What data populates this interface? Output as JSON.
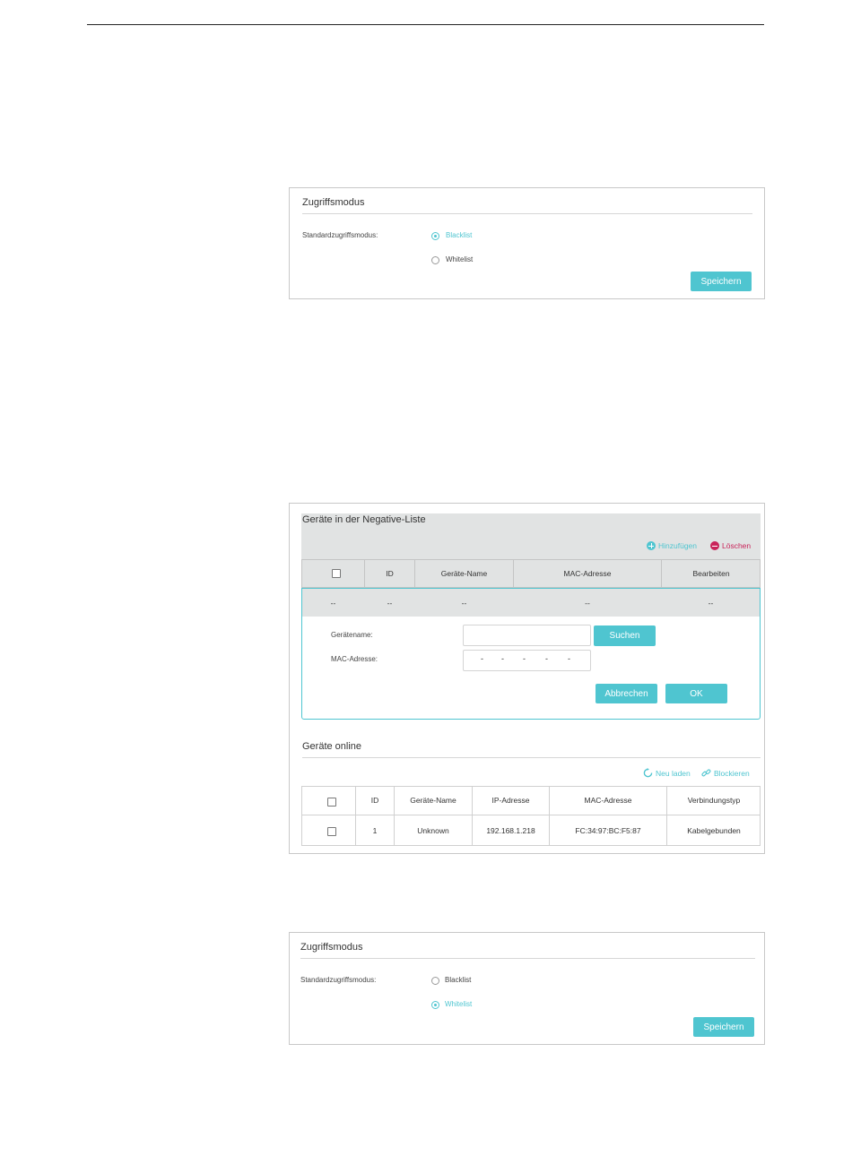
{
  "panel1": {
    "title": "Zugriffsmodus",
    "mode_label": "Standardzugriffsmodus:",
    "option_blacklist": "Blacklist",
    "option_whitelist": "Whitelist",
    "selected": "Blacklist",
    "save_label": "Speichern"
  },
  "panel2": {
    "title": "Geräte in der Negative-Liste",
    "add_label": "Hinzufügen",
    "delete_label": "Löschen",
    "columns": [
      "ID",
      "Geräte-Name",
      "MAC-Adresse",
      "Bearbeiten"
    ],
    "row": [
      "--",
      "--",
      "--",
      "--",
      "--"
    ],
    "form": {
      "device_name_label": "Gerätename:",
      "device_name_value": "",
      "search_label": "Suchen",
      "mac_label": "MAC-Adresse:",
      "mac_separators": [
        "-",
        "-",
        "-",
        "-",
        "-"
      ],
      "cancel_label": "Abbrechen",
      "ok_label": "OK"
    },
    "online": {
      "title": "Geräte online",
      "reload_label": "Neu laden",
      "block_label": "Blockieren",
      "columns": [
        "ID",
        "Geräte-Name",
        "IP-Adresse",
        "MAC-Adresse",
        "Verbindungstyp"
      ],
      "rows": [
        {
          "id": "1",
          "name": "Unknown",
          "ip": "192.168.1.218",
          "mac": "FC:34:97:BC:F5:87",
          "type": "Kabelgebunden"
        }
      ]
    }
  },
  "panel3": {
    "title": "Zugriffsmodus",
    "mode_label": "Standardzugriffsmodus:",
    "option_blacklist": "Blacklist",
    "option_whitelist": "Whitelist",
    "selected": "Whitelist",
    "save_label": "Speichern"
  },
  "colors": {
    "accent": "#4fc5d0",
    "delete": "#c9245a",
    "table_header_bg": "#e1e3e3"
  }
}
